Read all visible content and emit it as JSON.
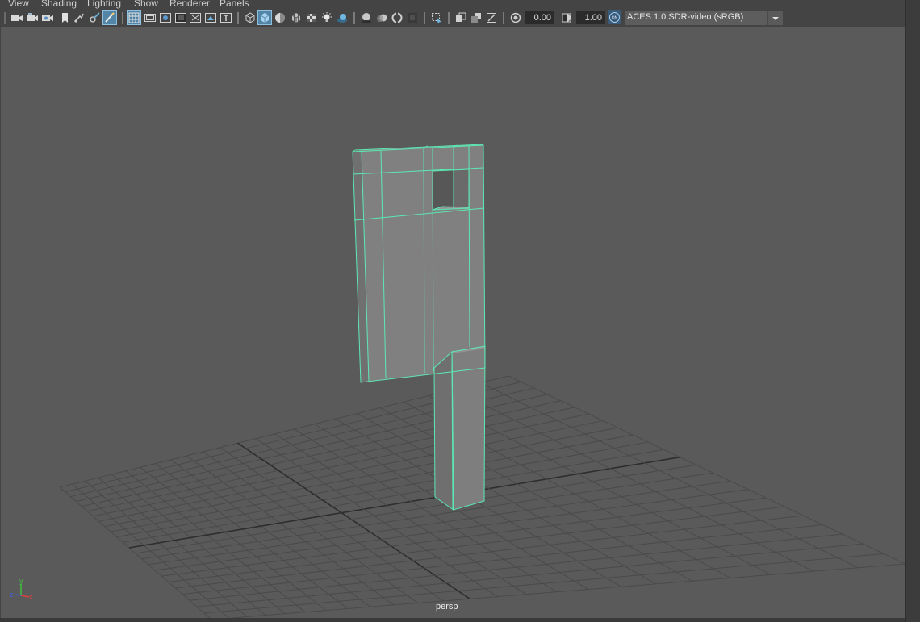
{
  "menubar": {
    "items": [
      {
        "label": "View"
      },
      {
        "label": "Shading"
      },
      {
        "label": "Lighting"
      },
      {
        "label": "Show"
      },
      {
        "label": "Renderer"
      },
      {
        "label": "Panels"
      }
    ]
  },
  "toolbar": {
    "icons": [
      "select-camera-icon",
      "camera-attributes-icon",
      "bookmarks-icon",
      "image-plane-icon",
      "two-d-pan-zoom-icon",
      "grease-pencil-icon",
      "grid-icon",
      "film-gate-icon",
      "resolution-gate-icon",
      "gate-mask-icon",
      "field-chart-icon",
      "safe-title-icon",
      "wireframe-icon",
      "smooth-shade-icon",
      "use-default-material-icon",
      "wireframe-on-shaded-icon",
      "textured-icon",
      "use-all-lights-icon",
      "shadows-icon",
      "screen-space-ambient-occlusion-icon",
      "motion-blur-icon",
      "anti-aliasing-icon",
      "depth-of-field-icon",
      "isolate-select-icon",
      "xray-icon",
      "xray-active-components-icon",
      "xray-joints-icon",
      "exposure-icon",
      "gamma-icon",
      "color-management-icon"
    ],
    "exposure_value": "0.00",
    "gamma_value": "1.00",
    "color_management_badge": "ON",
    "view_transform": "ACES 1.0 SDR-video (sRGB)"
  },
  "viewport": {
    "camera_label": "persp",
    "axis_labels": {
      "x": "x",
      "y": "y",
      "z": "z"
    },
    "colors": {
      "background": "#5a5a5a",
      "grid_line": "#4a4a4a",
      "grid_axis": "#2e2e2e",
      "selection_wire": "#5ce8b4",
      "mesh_face": "#7e7e7e",
      "mesh_face_dark": "#6d6d6d",
      "axis_x": "#e04040",
      "axis_y": "#40c040",
      "axis_z": "#4060e0",
      "accent": "#5285a6"
    }
  }
}
